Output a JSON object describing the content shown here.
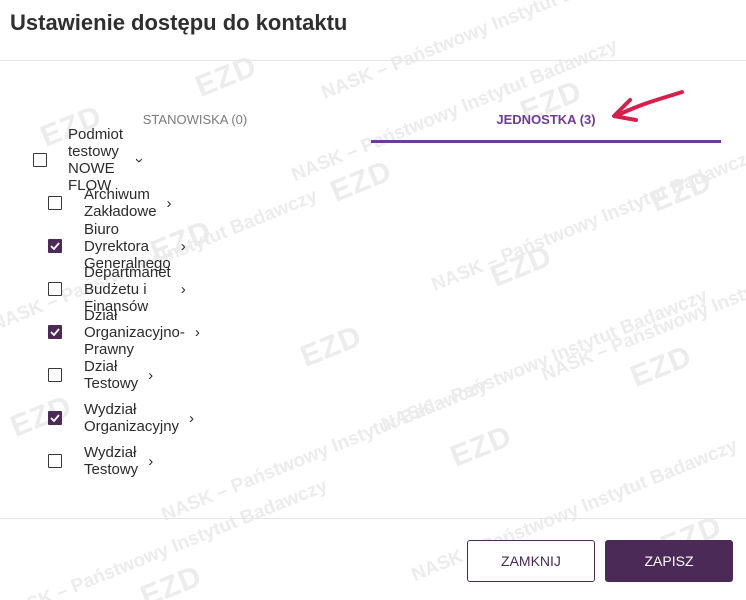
{
  "dialog": {
    "title": "Ustawienie dostępu do kontaktu"
  },
  "tabs": [
    {
      "label": "STANOWISKA (0)",
      "active": false
    },
    {
      "label": "JEDNOSTKA (3)",
      "active": true
    }
  ],
  "tree": {
    "root": {
      "label": "Podmiot testowy NOWE FLOW",
      "checked": false,
      "expanded": true
    },
    "children": [
      {
        "label": "Archiwum Zakładowe",
        "checked": false
      },
      {
        "label": "Biuro Dyrektora Generalnego",
        "checked": true
      },
      {
        "label": "Departmanet Budżetu i Finansów",
        "checked": false
      },
      {
        "label": "Dział Organizacyjno-Prawny",
        "checked": true
      },
      {
        "label": "Dział Testowy",
        "checked": false
      },
      {
        "label": "Wydział Organizacyjny",
        "checked": true
      },
      {
        "label": "Wydział Testowy",
        "checked": false
      }
    ]
  },
  "footer": {
    "close_label": "ZAMKNIJ",
    "save_label": "ZAPISZ"
  },
  "watermark": {
    "logo": "EZD",
    "text": "NASK – Państwowy Instytut Badawczy"
  },
  "colors": {
    "accent": "#6f3a9a",
    "primary_button": "#4b2a57",
    "annotation_arrow": "#d61f4a"
  }
}
